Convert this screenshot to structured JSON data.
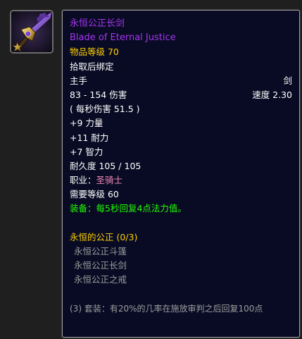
{
  "item": {
    "name_cn": "永恒公正长剑",
    "name_en": "Blade of Eternal Justice",
    "item_level": "物品等级 70",
    "bind": "拾取后绑定",
    "slot": "主手",
    "weapon_type": "剑",
    "damage": "83 - 154 伤害",
    "speed": "速度 2.30",
    "dps": "( 每秒伤害 51.5 )",
    "stats": [
      "+9 力量",
      "+11 耐力",
      "+7 智力"
    ],
    "durability": "耐久度 105 / 105",
    "class_label": "职业：",
    "class_name": "圣骑士",
    "required_level": "需要等级 60",
    "equip_effect": "装备：每5秒回复4点法力值。"
  },
  "set": {
    "title": "永恒的公正 (0/3)",
    "items": [
      "永恒公正斗篷",
      "永恒公正长剑",
      "永恒公正之戒"
    ],
    "bonus": "(3) 套装：有20%的几率在施放审判之后回复100点"
  },
  "colors": {
    "epic": "#a335ee",
    "gold": "#ffd100",
    "green": "#1eff00",
    "paladin": "#f58cba",
    "gray": "#9d9d9d",
    "tooltip_bg": "#090b24"
  },
  "icon": "sword-item-icon"
}
